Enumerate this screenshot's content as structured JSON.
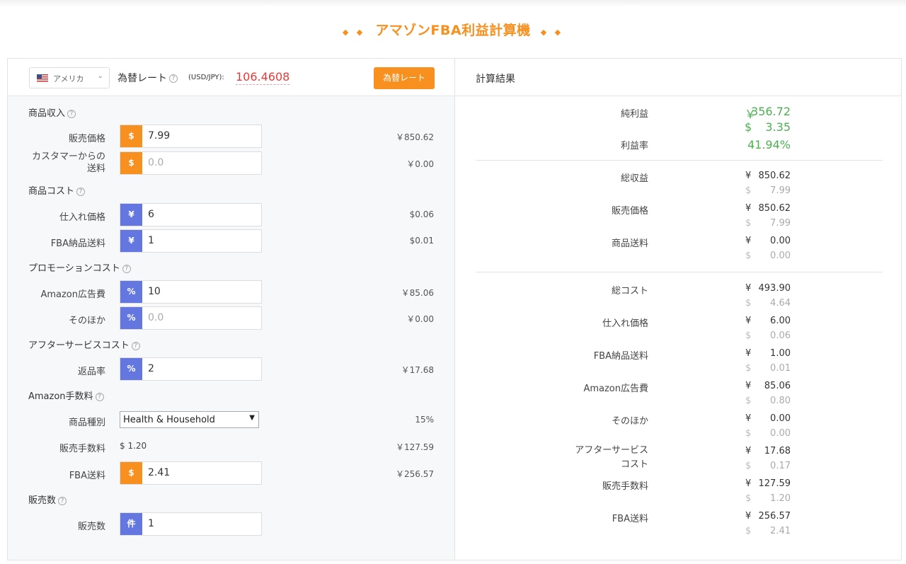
{
  "header": {
    "title": "アマゾンFBA利益計算機",
    "diamonds": "◆ ◆"
  },
  "rate_bar": {
    "country": "アメリカ",
    "rate_label": "為替レート",
    "rate_unit": "(USD/JPY):",
    "rate_value": "106.4608",
    "rate_button": "為替レート"
  },
  "sections": {
    "product_income": "商品収入",
    "product_cost": "商品コスト",
    "promotion_cost": "プロモーションコスト",
    "after_service": "アフターサービスコスト",
    "amazon_fee": "Amazon手数料",
    "sales_count": "販売数"
  },
  "inputs": {
    "sale_price": {
      "label": "販売価格",
      "prefix": "$",
      "value": "7.99",
      "converted": "￥850.62"
    },
    "shipping": {
      "label_line1": "カスタマーからの",
      "label_line2": "送料",
      "prefix": "$",
      "placeholder": "0.0",
      "converted": "￥0.00"
    },
    "purchase_price": {
      "label": "仕入れ価格",
      "prefix": "¥",
      "value": "6",
      "converted": "$0.06"
    },
    "fba_inbound": {
      "label": "FBA納品送料",
      "prefix": "¥",
      "value": "1",
      "converted": "$0.01"
    },
    "ad_cost": {
      "label": "Amazon広告費",
      "prefix": "%",
      "value": "10",
      "converted": "￥85.06"
    },
    "other": {
      "label": "そのほか",
      "prefix": "%",
      "placeholder": "0.0",
      "converted": "￥0.00"
    },
    "return_rate": {
      "label": "返品率",
      "prefix": "%",
      "value": "2",
      "converted": "￥17.68"
    },
    "category": {
      "label": "商品種別",
      "value": "Health & Household",
      "converted": "15%"
    },
    "sales_fee": {
      "label": "販売手数料",
      "value": "$ 1.20",
      "converted": "￥127.59"
    },
    "fba_fee": {
      "label": "FBA送料",
      "prefix": "$",
      "value": "2.41",
      "converted": "￥256.57"
    },
    "quantity": {
      "label": "販売数",
      "prefix": "件",
      "value": "1"
    }
  },
  "results": {
    "title": "計算結果",
    "net_profit": {
      "label": "純利益",
      "yen_symbol": "￥",
      "yen": "356.72",
      "usd_symbol": "$",
      "usd": "3.35"
    },
    "margin": {
      "label": "利益率",
      "value": "41.94%"
    },
    "yen_symbol": "¥",
    "usd_symbol": "$",
    "revenue_rows": [
      {
        "label": "総収益",
        "yen": "850.62",
        "usd": "7.99"
      },
      {
        "label": "販売価格",
        "yen": "850.62",
        "usd": "7.99"
      },
      {
        "label": "商品送料",
        "yen": "0.00",
        "usd": "0.00"
      }
    ],
    "cost_rows": [
      {
        "label": "総コスト",
        "yen": "493.90",
        "usd": "4.64"
      },
      {
        "label": "仕入れ価格",
        "yen": "6.00",
        "usd": "0.06"
      },
      {
        "label": "FBA納品送料",
        "yen": "1.00",
        "usd": "0.01"
      },
      {
        "label": "Amazon広告費",
        "yen": "85.06",
        "usd": "0.80"
      },
      {
        "label": "そのほか",
        "yen": "0.00",
        "usd": "0.00"
      },
      {
        "label": "アフターサービス",
        "label2": "コスト",
        "yen": "17.68",
        "usd": "0.17"
      },
      {
        "label": "販売手数料",
        "yen": "127.59",
        "usd": "1.20"
      },
      {
        "label": "FBA送料",
        "yen": "256.57",
        "usd": "2.41"
      }
    ]
  },
  "colors": {
    "accent": "#f7901e",
    "blue_prefix": "#6477e0",
    "profit_green": "#4caf50",
    "rate_red": "#e63a3a"
  }
}
